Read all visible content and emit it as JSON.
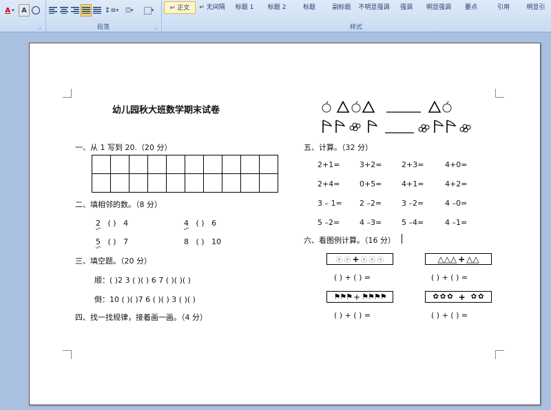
{
  "ribbon": {
    "paragraph_group_label": "段落",
    "styles_group_label": "样式",
    "font_color_label": "A",
    "char_shading_label": "A",
    "styles": [
      {
        "label": "↵ 正文",
        "selected": true
      },
      {
        "label": "↵ 无间隔",
        "selected": false
      },
      {
        "label": "标题 1",
        "selected": false
      },
      {
        "label": "标题 2",
        "selected": false
      },
      {
        "label": "标题",
        "selected": false
      },
      {
        "label": "副标题",
        "selected": false
      },
      {
        "label": "不明显强调",
        "selected": false
      },
      {
        "label": "强调",
        "selected": false
      },
      {
        "label": "明显强调",
        "selected": false
      },
      {
        "label": "要点",
        "selected": false
      },
      {
        "label": "引用",
        "selected": false
      },
      {
        "label": "明显引",
        "selected": false
      }
    ]
  },
  "doc": {
    "title": "幼儿园秋大班数学期末试卷",
    "s1": "一、从 1 写到 20.（20 分）",
    "s2": "二、填相邻的数。（8 分）",
    "s2_rows": [
      [
        "2",
        "(    )",
        "4"
      ],
      [
        "4",
        "(    )",
        "6"
      ],
      [
        "5",
        "(    )",
        "7"
      ],
      [
        "8",
        "(    )",
        "10"
      ]
    ],
    "s3": "三、填空题。（20 分）",
    "s3_forward": "顺：(    )2   3  (    )(    )  6   7  (    )(    )(    )",
    "s3_backward": "倒：10  (    )(    )7   6  (    )(    )  3  (    )(    )",
    "s4": "四、找一找规律，接着画一画。（4 分）",
    "s5": "五、计算。（32 分）",
    "calc": [
      [
        "2+1=",
        "3+2=",
        "2+3=",
        "4+0="
      ],
      [
        "2+4=",
        "0+5=",
        "4+1=",
        "4+2="
      ],
      [
        "3 – 1=",
        "2 –2=",
        "3 –2=",
        "4 –0="
      ],
      [
        "5 –2=",
        "4 –3=",
        "5 –4=",
        "4 –1="
      ]
    ],
    "s6": "六、看图例计算。（16 分）",
    "blank_eq": "(     ) + (     ) =",
    "plus": "+"
  }
}
